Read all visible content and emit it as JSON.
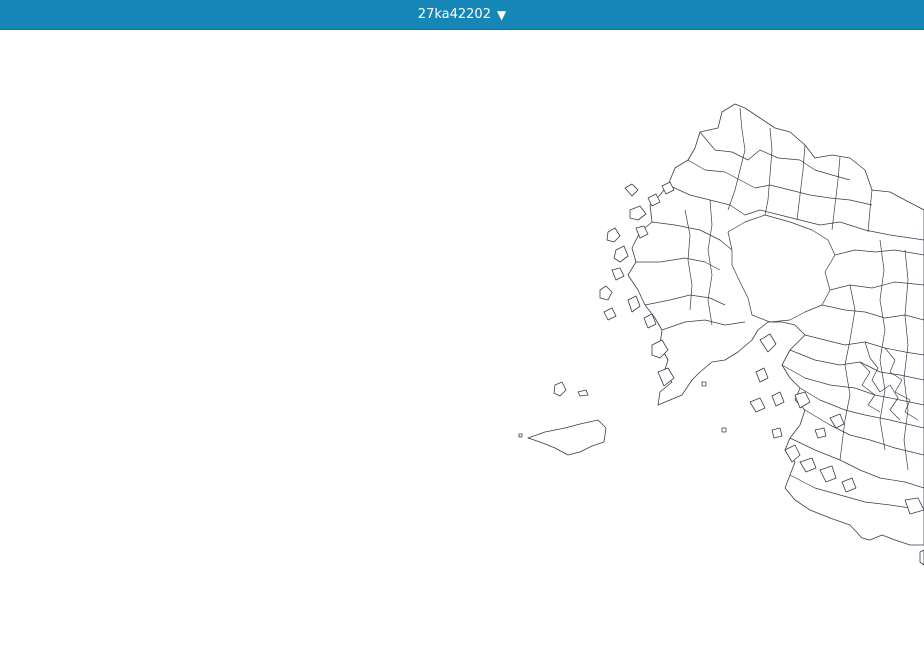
{
  "header": {
    "code_selector": {
      "value": "27ka42202",
      "icon": "triangle-down-icon"
    }
  },
  "map": {
    "background_color": "#ffffff",
    "boundary_color": "#3a3a4a",
    "header_color": "#1686b7"
  }
}
